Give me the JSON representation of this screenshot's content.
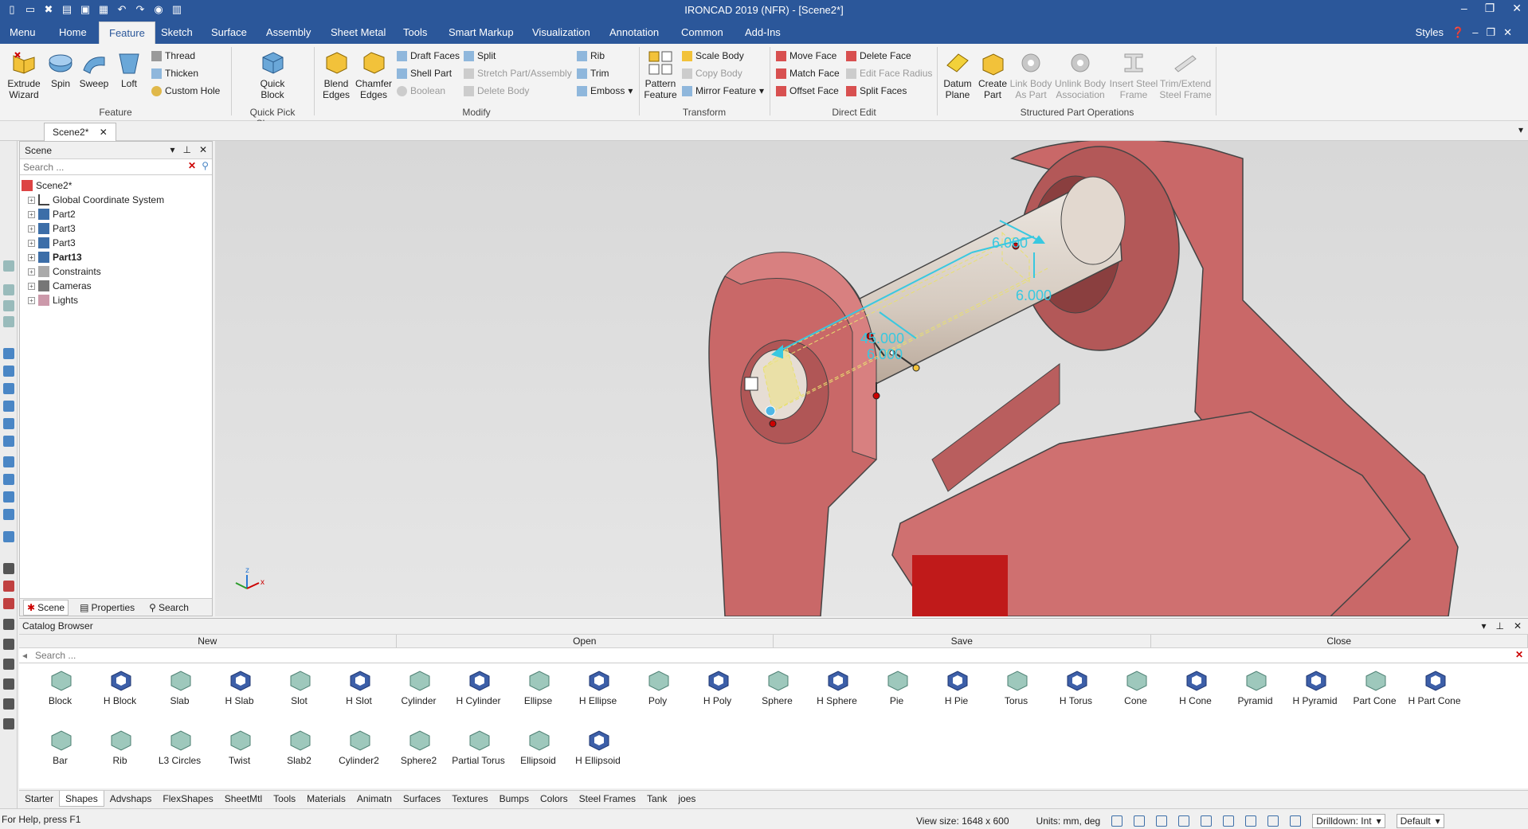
{
  "app": {
    "title": "IRONCAD 2019 (NFR) - [Scene2*]",
    "win_min": "–",
    "win_max": "❐",
    "win_close": "✕"
  },
  "menu": {
    "items": [
      "Menu",
      "Home",
      "Feature",
      "Sketch",
      "Surface",
      "Assembly",
      "Sheet Metal",
      "Tools",
      "Smart Markup",
      "Visualization",
      "Annotation",
      "Common",
      "Add-Ins"
    ],
    "styles": "Styles"
  },
  "ribbon": {
    "feature": {
      "extrude": "Extrude Wizard",
      "spin": "Spin",
      "sweep": "Sweep",
      "loft": "Loft",
      "thread": "Thread",
      "thicken": "Thicken",
      "custom_hole": "Custom Hole",
      "label": "Feature"
    },
    "quick": {
      "quick_block": "Quick Block",
      "label": "Quick Pick Shapes"
    },
    "modify": {
      "blend": "Blend Edges",
      "chamfer": "Chamfer Edges",
      "draft": "Draft Faces",
      "shell": "Shell Part",
      "boolean": "Boolean",
      "split": "Split",
      "stretch": "Stretch Part/Assembly",
      "delete_body": "Delete Body",
      "rib": "Rib",
      "trim": "Trim",
      "emboss": "Emboss",
      "label": "Modify"
    },
    "transform": {
      "pattern": "Pattern Feature",
      "scale": "Scale Body",
      "copy": "Copy Body",
      "mirror": "Mirror Feature",
      "label": "Transform"
    },
    "direct_edit": {
      "move_face": "Move Face",
      "match_face": "Match Face",
      "offset_face": "Offset Face",
      "delete_face": "Delete Face",
      "edit_radius": "Edit Face Radius",
      "split_faces": "Split Faces",
      "label": "Direct Edit"
    },
    "structured": {
      "datum": "Datum Plane",
      "create_part": "Create Part",
      "link_body": "Link Body As Part",
      "unlink": "Unlink Body Association",
      "insert_steel": "Insert Steel Frame",
      "trim_steel": "Trim/Extend Steel Frame",
      "label": "Structured Part Operations"
    }
  },
  "doc_tab": "Scene2*",
  "scene": {
    "title": "Scene",
    "search_placeholder": "Search ...",
    "tree": [
      "Scene2*",
      "Global Coordinate System",
      "Part2",
      "Part3",
      "Part3",
      "Part13",
      "Constraints",
      "Cameras",
      "Lights"
    ],
    "tabs": [
      "Scene",
      "Properties",
      "Search"
    ]
  },
  "viewport": {
    "dims": [
      "6.000",
      "6.000",
      "45.000",
      "6.000"
    ],
    "axis": {
      "z": "z",
      "x": "x"
    }
  },
  "catalog": {
    "title": "Catalog Browser",
    "actions": [
      "New",
      "Open",
      "Save",
      "Close"
    ],
    "search_placeholder": "Search ...",
    "row1": [
      "Block",
      "H Block",
      "Slab",
      "H Slab",
      "Slot",
      "H Slot",
      "Cylinder",
      "H Cylinder",
      "Ellipse",
      "H Ellipse",
      "Poly",
      "H Poly",
      "Sphere",
      "H Sphere",
      "Pie",
      "H Pie",
      "Torus",
      "H Torus",
      "Cone",
      "H Cone",
      "Pyramid",
      "H Pyramid",
      "Part Cone",
      "H Part Cone"
    ],
    "row2": [
      "Bar",
      "Rib",
      "L3 Circles",
      "Twist",
      "Slab2",
      "Cylinder2",
      "Sphere2",
      "Partial Torus",
      "Ellipsoid",
      "H Ellipsoid"
    ],
    "tabs": [
      "Starter",
      "Shapes",
      "Advshaps",
      "FlexShapes",
      "SheetMtl",
      "Tools",
      "Materials",
      "Animatn",
      "Surfaces",
      "Textures",
      "Bumps",
      "Colors",
      "Steel Frames",
      "Tank",
      "joes"
    ],
    "active_tab": "Shapes"
  },
  "status": {
    "help": "For Help, press F1",
    "view_size": "View size: 1648 x 600",
    "units": "Units: mm, deg",
    "drilldown": "Drilldown: Int",
    "preset": "Default"
  },
  "colors": {
    "accent": "#2b579a",
    "part": "#c96a6a",
    "dim": "#38c8e0"
  }
}
